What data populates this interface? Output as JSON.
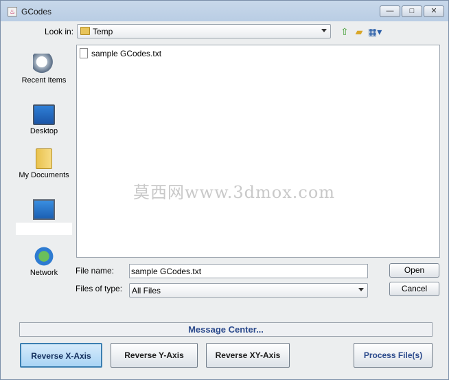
{
  "window": {
    "title": "GCodes",
    "icon": "java-app-icon"
  },
  "titlebar_buttons": {
    "minimize": "—",
    "maximize": "□",
    "close": "✕"
  },
  "lookin": {
    "label": "Look in:",
    "value": "Temp",
    "toolbar_icons": [
      "up-folder-icon",
      "new-folder-icon",
      "view-menu-icon"
    ]
  },
  "places": [
    {
      "label": "Recent Items",
      "icon": "recent-items-icon"
    },
    {
      "label": "Desktop",
      "icon": "desktop-icon"
    },
    {
      "label": "My Documents",
      "icon": "my-documents-icon"
    },
    {
      "label": "",
      "icon": "computer-icon"
    },
    {
      "label": "Network",
      "icon": "network-icon"
    }
  ],
  "files": [
    {
      "name": "sample GCodes.txt",
      "icon": "text-file-icon"
    }
  ],
  "watermark": "莫西网www.3dmox.com",
  "filename": {
    "label": "File name:",
    "value": "sample GCodes.txt"
  },
  "filetype": {
    "label": "Files of type:",
    "value": "All Files"
  },
  "buttons": {
    "open": "Open",
    "cancel": "Cancel"
  },
  "message_center": "Message Center...",
  "actions": {
    "reverse_x": "Reverse X-Axis",
    "reverse_y": "Reverse Y-Axis",
    "reverse_xy": "Reverse XY-Axis",
    "process": "Process File(s)"
  }
}
